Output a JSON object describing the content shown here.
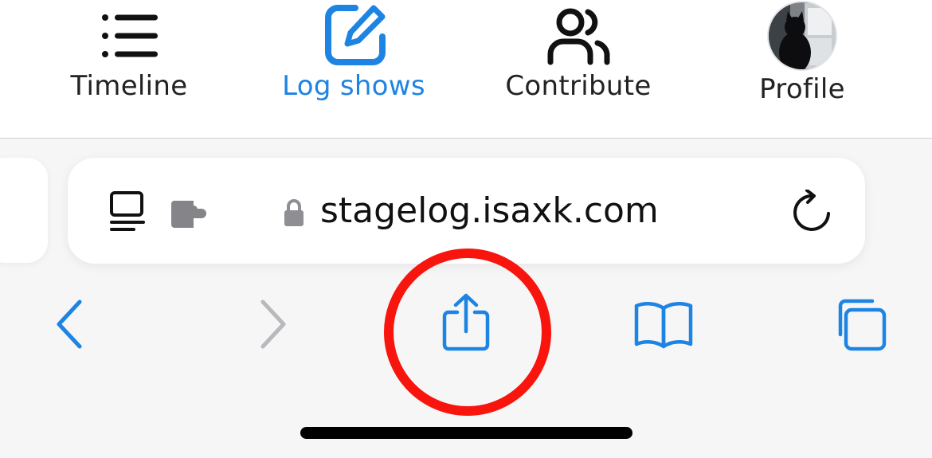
{
  "app_tabs": [
    {
      "label": "Timeline",
      "icon": "timeline-list-icon",
      "active": false
    },
    {
      "label": "Log shows",
      "icon": "log-shows-edit-icon",
      "active": true
    },
    {
      "label": "Contribute",
      "icon": "contribute-people-icon",
      "active": false
    },
    {
      "label": "Profile",
      "icon": "profile-avatar",
      "active": false
    }
  ],
  "browser": {
    "url": "stagelog.isaxk.com",
    "page_format_icon": "page-format-icon",
    "extension_icon": "extension-puzzle-icon",
    "lock_icon": "lock-icon",
    "reload_icon": "reload-icon"
  },
  "toolbar": {
    "back_icon": "back-chevron-icon",
    "forward_icon": "forward-chevron-icon",
    "share_icon": "share-icon",
    "bookmarks_icon": "bookmarks-book-icon",
    "tabs_icon": "tabs-overview-icon",
    "share_highlighted": true
  },
  "colors": {
    "accent": "#1d84e3",
    "text": "#111111",
    "disabled": "#b7b9bd",
    "highlight": "#f7150d",
    "background": "#f6f6f7"
  }
}
